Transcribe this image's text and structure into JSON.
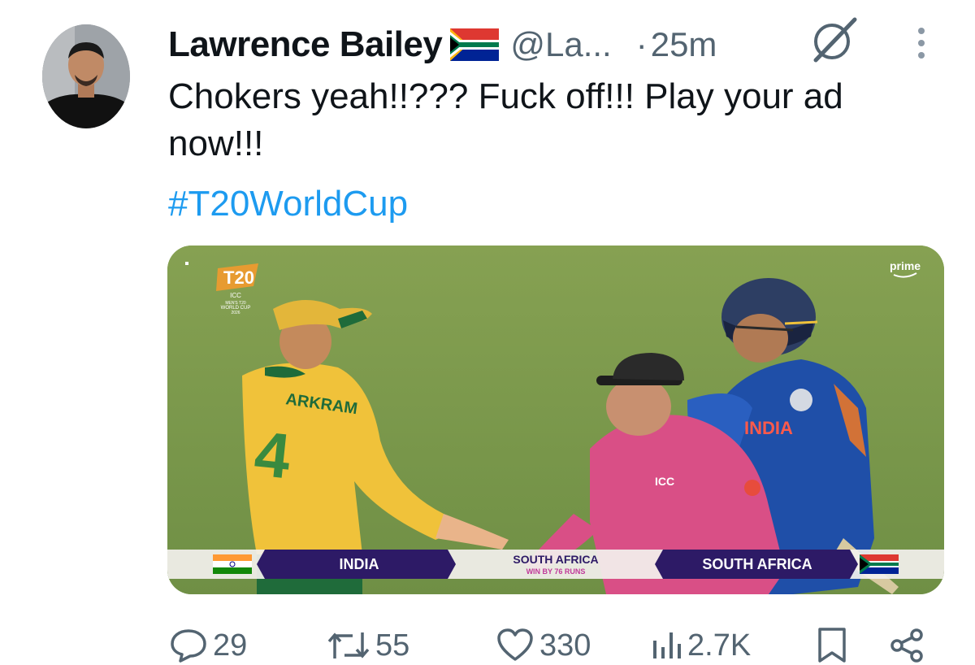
{
  "tweet": {
    "author_name": "Lawrence Bailey",
    "handle": "@La...",
    "separator": "·",
    "time": "25m",
    "text": "Chokers yeah!!??? Fuck off!!! Play your ad now!!!",
    "hashtag": "#T20WorldCup"
  },
  "media": {
    "logo_lines": [
      "ICC",
      "MEN'S T20",
      "WORLD CUP",
      "2026"
    ],
    "broadcaster": "prime",
    "scorebug": {
      "team_left": "INDIA",
      "result_team": "SOUTH AFRICA",
      "result_text": "WIN BY 76 RUNS",
      "team_right": "SOUTH AFRICA"
    },
    "jersey_name": "ARKRAM",
    "jersey_number": "4",
    "india_jersey_text": "INDIA",
    "umpire_logo": "ICC"
  },
  "actions": {
    "replies": "29",
    "reposts": "55",
    "likes": "330",
    "views": "2.7K"
  },
  "colors": {
    "text": "#0f1419",
    "secondary": "#536471",
    "link": "#1d9bf0",
    "pitch": "#7d9a4e",
    "sa_jersey": "#f0c23a",
    "india_jersey": "#1f4fa8",
    "umpire_shirt": "#d94f86",
    "scorebug_purple": "#2d1a66"
  },
  "icons": [
    "grok-icon",
    "more-icon",
    "reply-icon",
    "repost-icon",
    "like-icon",
    "views-icon",
    "bookmark-icon",
    "share-icon"
  ]
}
